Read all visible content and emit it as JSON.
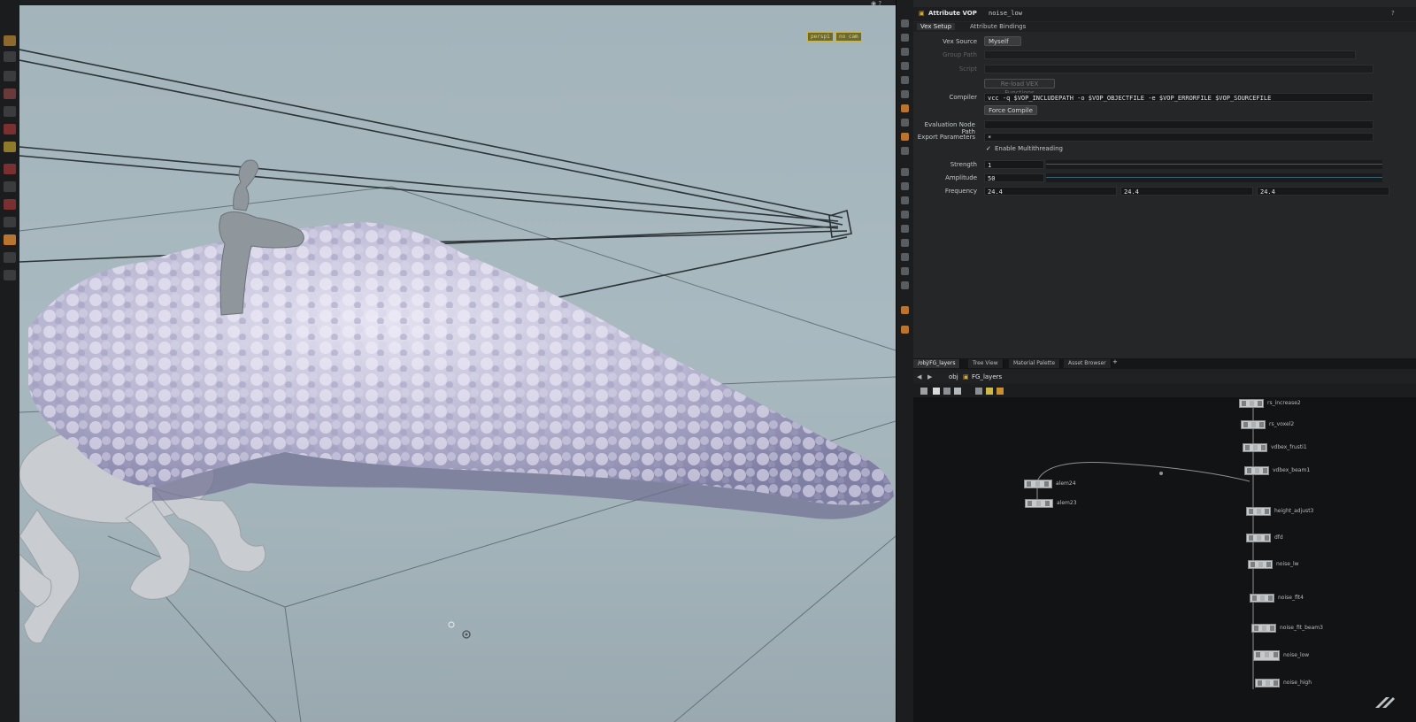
{
  "viewport": {
    "camera_label": "persp1",
    "cam_menu_label": "no cam"
  },
  "parameter_pane": {
    "node_type": "Attribute VOP",
    "node_name": "noise_low",
    "tabs": [
      "Vex Setup",
      "Attribute Bindings"
    ],
    "vex_source": {
      "label": "Vex Source",
      "value": "Myself"
    },
    "group_path": {
      "label": "Group Path",
      "value": ""
    },
    "script": {
      "label": "Script",
      "value": ""
    },
    "rebuild_label": "Re-load VEX Functions",
    "compiler": {
      "label": "Compiler",
      "value": "vcc -q $VOP_INCLUDEPATH -o $VOP_OBJECTFILE -e $VOP_ERRORFILE $VOP_SOURCEFILE"
    },
    "force_compile_label": "Force Compile",
    "evaluation_node_path": {
      "label": "Evaluation Node Path",
      "value": ""
    },
    "export_parameters": {
      "label": "Export Parameters",
      "value": "*"
    },
    "enable_multithreading": {
      "label": "Enable Multithreading",
      "checked": true
    },
    "strength": {
      "label": "Strength",
      "value": "1"
    },
    "amplitude": {
      "label": "Amplitude",
      "value": "50"
    },
    "frequency": {
      "label": "Frequency",
      "values": [
        "24.4",
        "24.4",
        "24.4"
      ]
    }
  },
  "network_pane": {
    "tabs": [
      "/obj/FG_layers",
      "Tree View",
      "Material Palette",
      "Asset Browser"
    ],
    "path": {
      "root": "obj",
      "node": "FG_layers"
    },
    "nodes": [
      {
        "label": "rs_increase2"
      },
      {
        "label": "rs_voxel2"
      },
      {
        "label": "vdbex_frusti1"
      },
      {
        "label": "vdbex_beam1"
      },
      {
        "label": "alem24"
      },
      {
        "label": "alem23"
      },
      {
        "label": "height_adjust3"
      },
      {
        "label": "dfd"
      },
      {
        "label": "noise_lw"
      },
      {
        "label": "noise_flt4"
      },
      {
        "label": "noise_fit_beam3"
      },
      {
        "label": "noise_low"
      },
      {
        "label": "noise_high"
      }
    ]
  }
}
